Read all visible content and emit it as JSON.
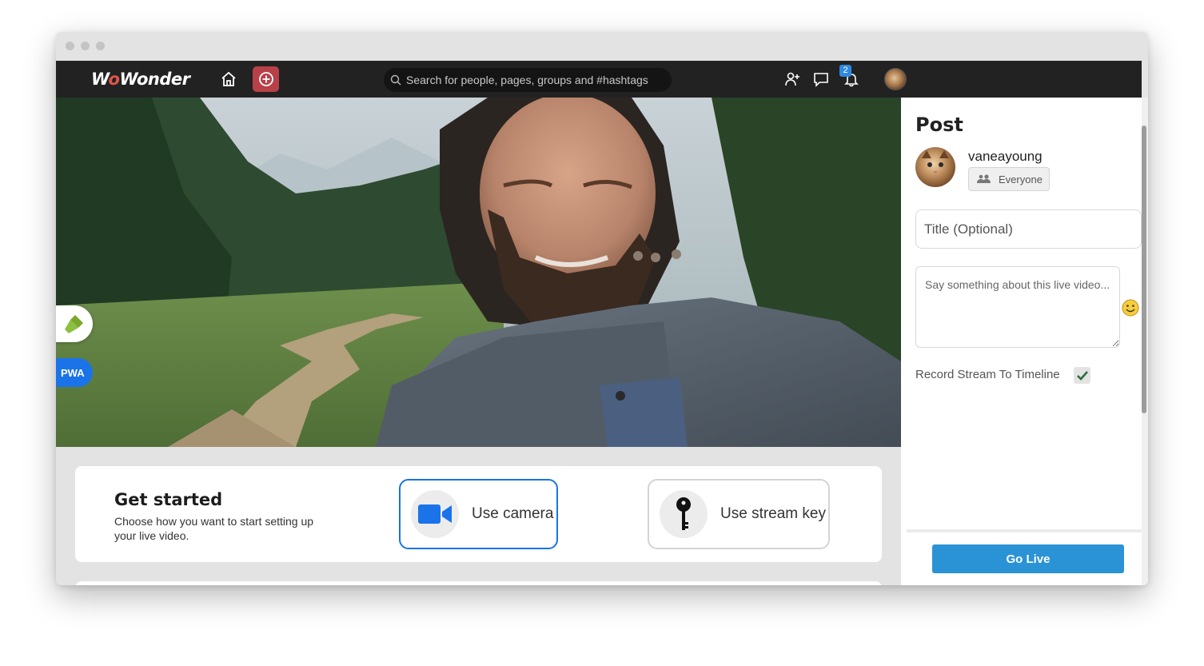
{
  "brand": {
    "logo_prefix": "W",
    "logo_o": "o",
    "logo_suffix": "Wonder",
    "create_color": "#b84048"
  },
  "search": {
    "placeholder": "Search for people, pages, groups and #hashtags"
  },
  "notifications": {
    "count": "2"
  },
  "side_buttons": {
    "pwa_label": "PWA"
  },
  "get_started": {
    "title": "Get started",
    "description": "Choose how you want to start setting up your live video.",
    "options": [
      {
        "label": "Use camera",
        "icon": "video-camera-icon"
      },
      {
        "label": "Use stream key",
        "icon": "key-icon"
      }
    ]
  },
  "post_panel": {
    "title": "Post",
    "username": "vaneayoung",
    "privacy_label": "Everyone",
    "title_placeholder": "Title (Optional)",
    "description_placeholder": "Say something about this live video...",
    "record_label": "Record Stream To Timeline",
    "record_checked": true,
    "go_live_label": "Go Live"
  },
  "colors": {
    "accent": "#2a93d5",
    "navbar": "#222222",
    "selected_border": "#1a73e8"
  }
}
